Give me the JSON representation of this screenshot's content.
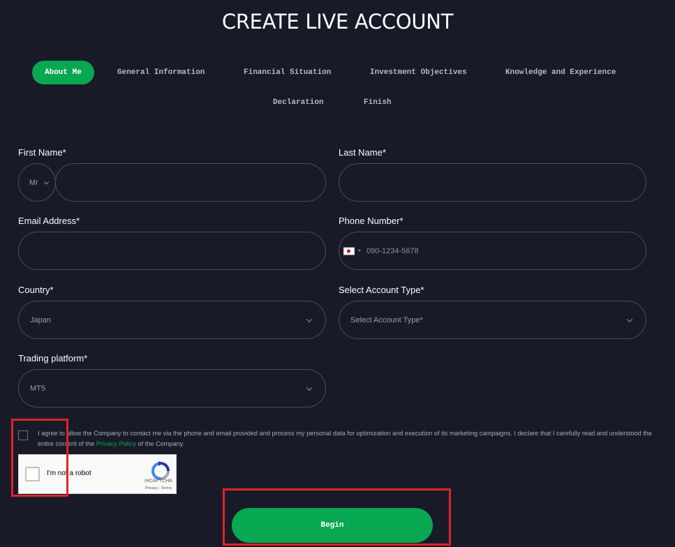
{
  "page": {
    "title": "CREATE LIVE ACCOUNT"
  },
  "steps": [
    {
      "label": "About Me",
      "active": true
    },
    {
      "label": "General Information",
      "active": false
    },
    {
      "label": "Financial Situation",
      "active": false
    },
    {
      "label": "Investment Objectives",
      "active": false
    },
    {
      "label": "Knowledge and Experience",
      "active": false
    },
    {
      "label": "Declaration",
      "active": false
    },
    {
      "label": "Finish",
      "active": false
    }
  ],
  "form": {
    "first_name": {
      "label": "First Name*",
      "value": "",
      "title_value": "Mr"
    },
    "last_name": {
      "label": "Last Name*",
      "value": ""
    },
    "email": {
      "label": "Email Address*",
      "value": ""
    },
    "phone": {
      "label": "Phone Number*",
      "placeholder": "090-1234-5678",
      "flag_icon": "japan-flag-icon"
    },
    "country": {
      "label": "Country*",
      "value": "Japan"
    },
    "account_type": {
      "label": "Select Account Type*",
      "value": "Select Account Type*"
    },
    "platform": {
      "label": "Trading platform*",
      "value": "MT5"
    }
  },
  "consent": {
    "text_before": "I agree to allow the Company to contact me via the phone and email provided and process my personal data for optimization and execution of its marketing campaigns. I declare that I carefully read and understood the entire content of the ",
    "link": "Privacy Policy",
    "text_after": " of the Company.",
    "checked": false
  },
  "captcha": {
    "label": "I'm not a robot",
    "brand": "reCAPTCHA",
    "terms": "Privacy - Terms"
  },
  "submit": {
    "label": "Begin"
  },
  "colors": {
    "background": "#181a28",
    "accent": "#08a751",
    "border": "#4a4d5e",
    "highlight": "#e02424"
  }
}
